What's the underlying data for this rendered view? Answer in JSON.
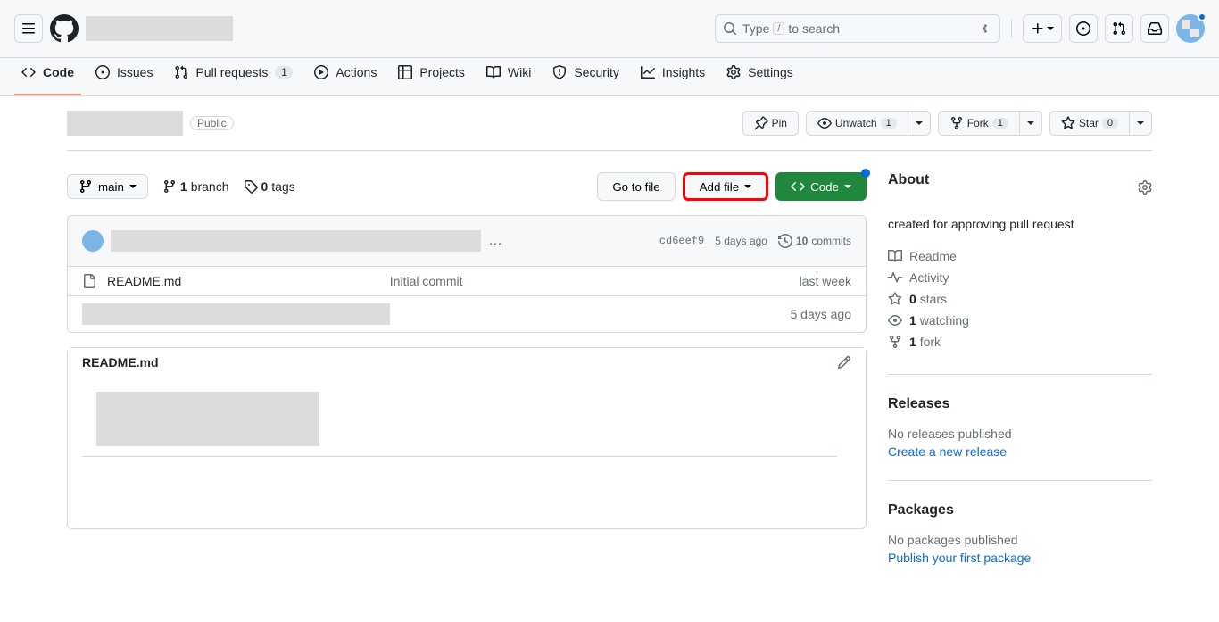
{
  "header": {
    "search_placeholder": "Type",
    "search_suffix": "to search",
    "search_kbd": "/"
  },
  "nav": {
    "code": "Code",
    "issues": "Issues",
    "pull_requests": "Pull requests",
    "pr_count": "1",
    "actions": "Actions",
    "projects": "Projects",
    "wiki": "Wiki",
    "security": "Security",
    "insights": "Insights",
    "settings": "Settings"
  },
  "repo": {
    "visibility": "Public",
    "actions": {
      "pin": "Pin",
      "unwatch": "Unwatch",
      "watch_count": "1",
      "fork": "Fork",
      "fork_count": "1",
      "star": "Star",
      "star_count": "0"
    }
  },
  "branch": {
    "name": "main",
    "branch_count": "1",
    "branch_label": "branch",
    "tag_count": "0",
    "tag_label": "tags"
  },
  "controls": {
    "go_to_file": "Go to file",
    "add_file": "Add file",
    "code": "Code"
  },
  "commit": {
    "hash": "cd6eef9",
    "date": "5 days ago",
    "count": "10",
    "count_label": "commits"
  },
  "files": [
    {
      "name": "README.md",
      "message": "Initial commit",
      "date": "last week",
      "icon": "file"
    },
    {
      "name": "",
      "message": "",
      "date": "5 days ago",
      "icon": "redacted"
    }
  ],
  "readme": {
    "title": "README.md"
  },
  "sidebar": {
    "about": {
      "title": "About",
      "description": "created for approving pull request"
    },
    "items": {
      "readme": "Readme",
      "activity": "Activity",
      "stars_count": "0",
      "stars_label": "stars",
      "watching_count": "1",
      "watching_label": "watching",
      "fork_count": "1",
      "fork_label": "fork"
    },
    "releases": {
      "title": "Releases",
      "none": "No releases published",
      "link": "Create a new release"
    },
    "packages": {
      "title": "Packages",
      "none": "No packages published",
      "link": "Publish your first package"
    }
  }
}
